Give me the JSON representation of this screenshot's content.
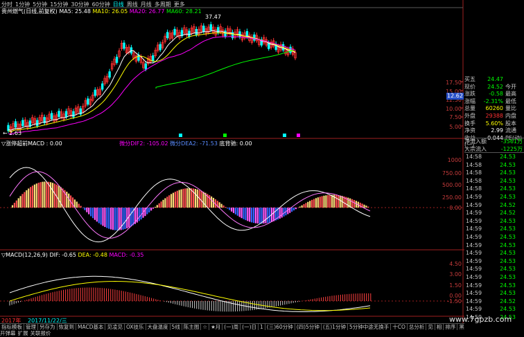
{
  "periods": {
    "items": [
      "分时",
      "1分钟",
      "5分钟",
      "15分钟",
      "30分钟",
      "60分钟",
      "日线",
      "周线",
      "月线",
      "多周期",
      "更多"
    ],
    "active": "日线"
  },
  "main": {
    "title": "贵州燃气(日线,前复权)",
    "ma5": "MA5: 25.48",
    "ma10": "MA10: 26.05",
    "ma20": "MA20: 26.77",
    "ma60": "MA60: 28.21",
    "peak_label": "37.47",
    "low_label": "← 2.63",
    "ticks": [
      "17.50",
      "15.00",
      "12.50",
      "10.00",
      "7.50",
      "5.00"
    ],
    "current": "12.62",
    "markers": [
      "资",
      "财",
      "财",
      "资"
    ]
  },
  "ind1": {
    "name": "▽涨停超前MACD : 0.00",
    "s1": "微分DIF2: -105.02",
    "s2": "微分DEA2: -71.53",
    "s3": "底背驰: 0.00",
    "ticks": [
      "1000",
      "750.00",
      "500.00",
      "250.00",
      "0.00"
    ]
  },
  "ind2": {
    "name": "▽MACD(12,26,9)",
    "dif": "DIF: -0.65",
    "dea": "DEA: -0.48",
    "macd": "MACD: -0.35",
    "ticks": [
      "4.50",
      "3.00",
      "1.50",
      "0.00",
      "-1.50"
    ]
  },
  "date": "2017/11/22/三",
  "year": "2017年",
  "tabs": [
    "指标模板",
    "管理",
    "另存为",
    "恢复到",
    "MACD基本",
    "见凌见",
    "OX技乐",
    "大盘温度",
    "5线",
    "陈主图",
    "☆",
    "★月",
    "(一)周",
    "(一)日",
    "1",
    "(三)60分钟",
    "(四)5分钟",
    "(五)1分钟",
    "5分钟中途无换手",
    "十CO",
    "总分析",
    "见",
    "相",
    "排序",
    "黑马均"
  ],
  "bottom": [
    "开弹幕",
    "扩展",
    "关联报价"
  ],
  "quote": {
    "rows": [
      {
        "k": "买五",
        "v": "24.47",
        "c": "grn",
        "k2": "",
        "v2": "",
        "c2": ""
      },
      {
        "k": "现价",
        "v": "24.52",
        "c": "grn",
        "k2": "今开",
        "v2": "",
        "c2": ""
      },
      {
        "k": "涨跌",
        "v": "-0.58",
        "c": "grn",
        "k2": "最高",
        "v2": "",
        "c2": ""
      },
      {
        "k": "涨幅",
        "v": "-2.31%",
        "c": "grn",
        "k2": "最低",
        "v2": "",
        "c2": ""
      },
      {
        "k": "总量",
        "v": "60260",
        "c": "yel",
        "k2": "量比",
        "v2": "",
        "c2": ""
      },
      {
        "k": "外盘",
        "v": "29388",
        "c": "red",
        "k2": "内盘",
        "v2": "",
        "c2": ""
      },
      {
        "k": "换手",
        "v": "5.60%",
        "c": "yel",
        "k2": "股本",
        "v2": "",
        "c2": ""
      },
      {
        "k": "净资",
        "v": "2.99",
        "c": "wht",
        "k2": "流通",
        "v2": "",
        "c2": ""
      },
      {
        "k": "收益(一)",
        "v": "0.044",
        "c": "wht",
        "k2": "PE(动)",
        "v2": "",
        "c2": ""
      }
    ],
    "flows": [
      {
        "k": "净流入额",
        "v": "-3561万",
        "c": "grn"
      },
      {
        "k": "大宗流入",
        "v": "-1225万",
        "c": "grn"
      }
    ]
  },
  "ticks_list": {
    "time": "14:59",
    "rows": [
      {
        "t": "14:58",
        "p": "24.53"
      },
      {
        "t": "14:58",
        "p": "24.53"
      },
      {
        "t": "14:58",
        "p": "24.53"
      },
      {
        "t": "14:58",
        "p": "24.53"
      },
      {
        "t": "14:58",
        "p": "24.53"
      },
      {
        "t": "14:59",
        "p": "24.53"
      },
      {
        "t": "14:59",
        "p": "24.52"
      },
      {
        "t": "14:59",
        "p": "24.52"
      },
      {
        "t": "14:59",
        "p": "24.53"
      },
      {
        "t": "14:59",
        "p": "24.53"
      },
      {
        "t": "14:59",
        "p": "24.53"
      },
      {
        "t": "14:59",
        "p": "24.53"
      },
      {
        "t": "14:59",
        "p": "24.53"
      },
      {
        "t": "14:59",
        "p": "24.53"
      },
      {
        "t": "14:59",
        "p": "24.53"
      },
      {
        "t": "14:59",
        "p": "24.53"
      },
      {
        "t": "14:59",
        "p": "24.53"
      },
      {
        "t": "14:59",
        "p": "24.53"
      },
      {
        "t": "14:59",
        "p": "24.52"
      },
      {
        "t": "14:59",
        "p": "24.53"
      },
      {
        "t": "14:59",
        "p": "24.53"
      }
    ]
  },
  "watermark": "www.7gpzb.com",
  "colors": {
    "up": "#ff3232",
    "down": "#00ffff",
    "ma5": "#ffffff",
    "ma10": "#ffff00",
    "ma20": "#ff00ff",
    "ma60": "#00ff00"
  }
}
